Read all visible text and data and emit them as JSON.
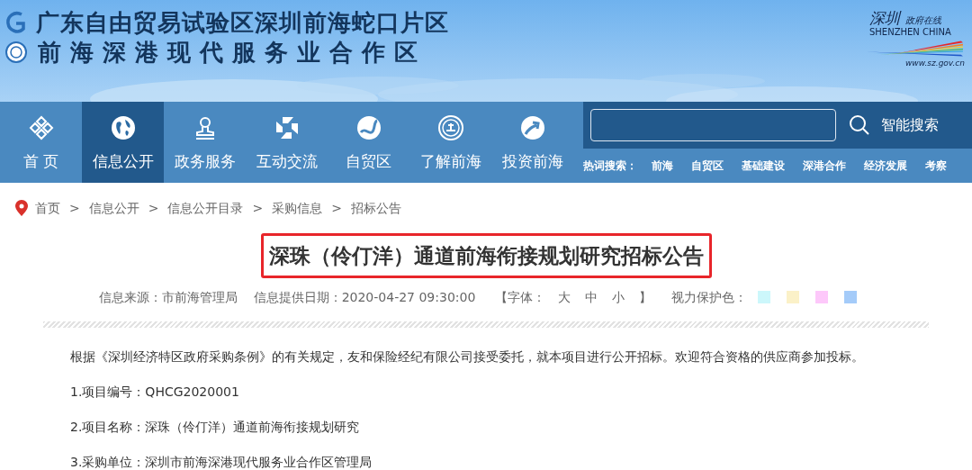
{
  "header": {
    "title_line_1": "广东自由贸易试验区深圳前海蛇口片区",
    "title_line_2": "前海深港现代服务业合作区",
    "brand": {
      "script": "深圳",
      "script_2": "政府在线",
      "name": "SHENZHEN CHINA",
      "url": "www.sz.gov.cn"
    }
  },
  "nav": {
    "items": [
      {
        "label": "首 页",
        "selected": false
      },
      {
        "label": "信息公开",
        "selected": true
      },
      {
        "label": "政务服务",
        "selected": false
      },
      {
        "label": "互动交流",
        "selected": false
      },
      {
        "label": "自贸区",
        "selected": false
      },
      {
        "label": "了解前海",
        "selected": false
      },
      {
        "label": "投资前海",
        "selected": false
      }
    ]
  },
  "search": {
    "button_label": "智能搜索",
    "hot_label": "热词搜索：",
    "hot_words": [
      "前海",
      "自贸区",
      "基础建设",
      "深港合作",
      "经济发展",
      "考察"
    ]
  },
  "breadcrumb": {
    "separator": ">",
    "items": [
      "首页",
      "信息公开",
      "信息公开目录",
      "采购信息",
      "招标公告"
    ]
  },
  "article": {
    "title": "深珠（伶仃洋）通道前海衔接规划研究招标公告",
    "source": "信息来源：市前海管理局",
    "date": "信息提供日期：2020-04-27 09:30:00",
    "font_size": {
      "open": "【字体：",
      "sizes": [
        "大",
        "中",
        "小"
      ],
      "close": "】"
    },
    "eye_care": {
      "label": "视力保护色：",
      "colors": [
        {
          "color": "#ccf7fb"
        },
        {
          "color": "#fbf1c8"
        },
        {
          "color": "#fdc8fa"
        },
        {
          "color": "#a4cbf9"
        }
      ]
    },
    "paragraphs": [
      "根据《深圳经济特区政府采购条例》的有关规定，友和保险经纪有限公司接受委托，就本项目进行公开招标。欢迎符合资格的供应商参加投标。",
      "1.项目编号：QHCG2020001",
      "2.项目名称：深珠（伶仃洋）通道前海衔接规划研究",
      "3.采购单位：深圳市前海深港现代服务业合作区管理局"
    ]
  }
}
